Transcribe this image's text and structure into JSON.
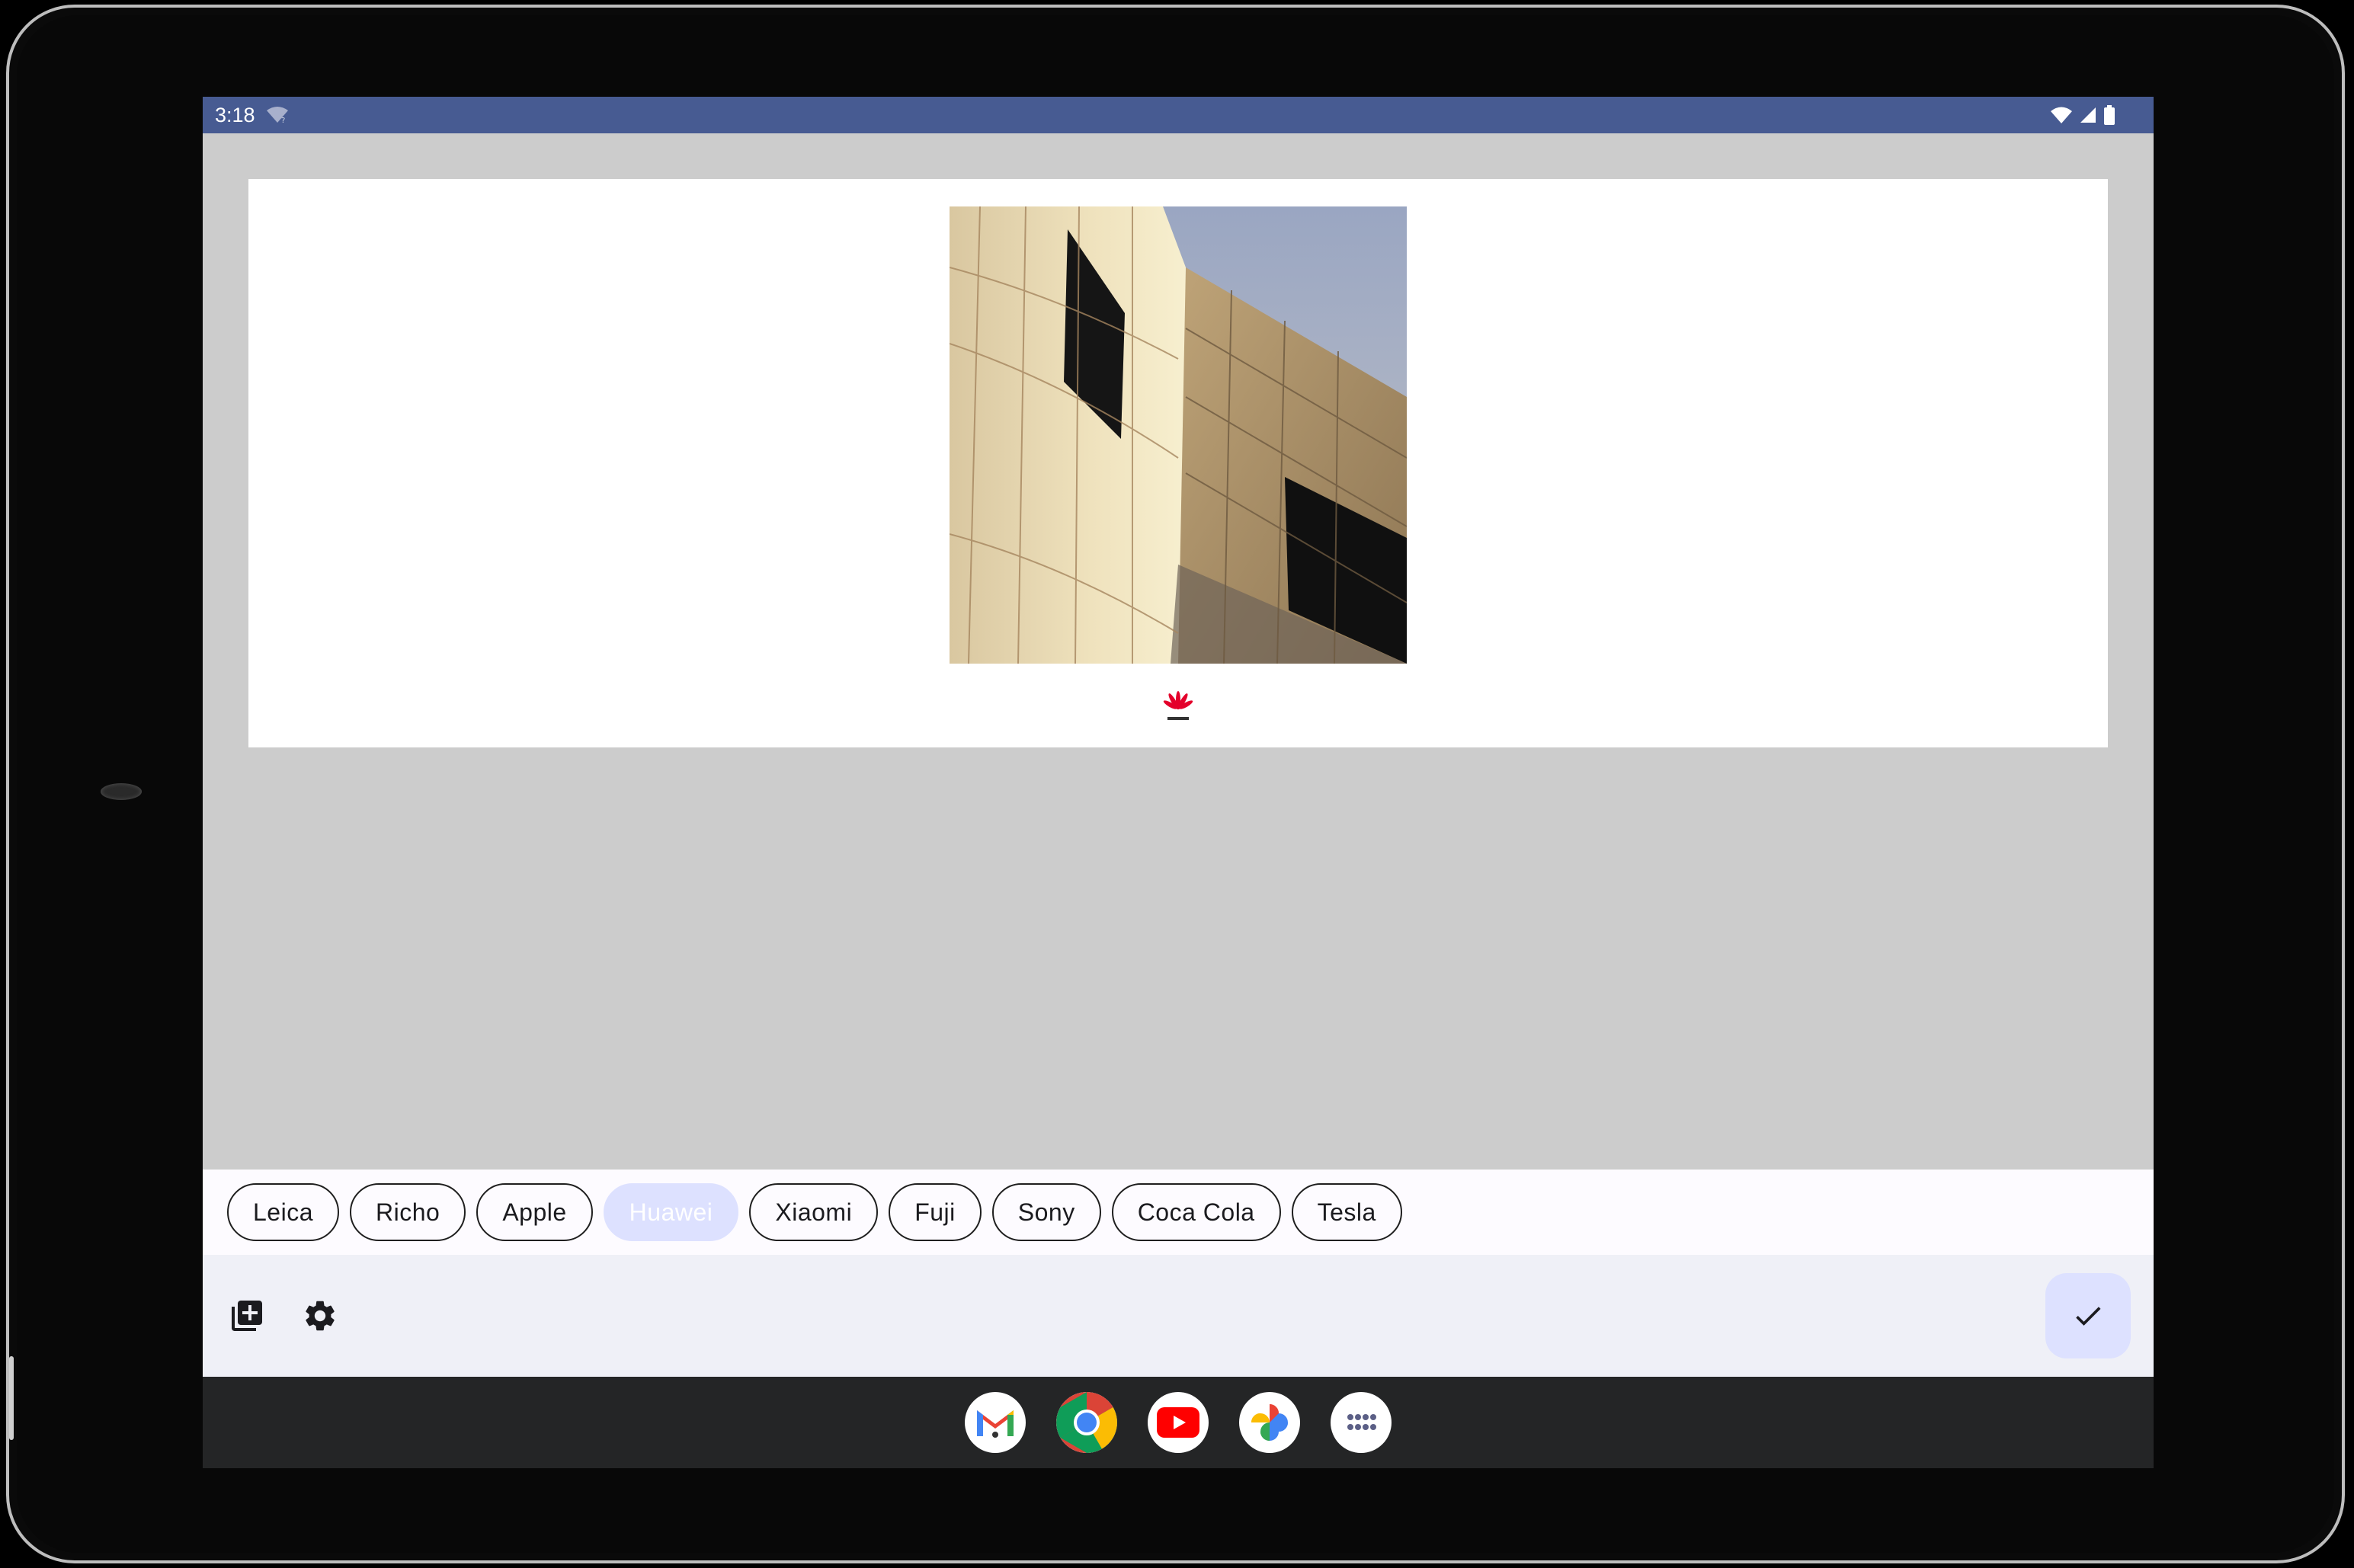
{
  "status_bar": {
    "time": "3:18"
  },
  "chips": [
    {
      "label": "Leica",
      "selected": false
    },
    {
      "label": "Richo",
      "selected": false
    },
    {
      "label": "Apple",
      "selected": false
    },
    {
      "label": "Huawei",
      "selected": true
    },
    {
      "label": "Xiaomi",
      "selected": false
    },
    {
      "label": "Fuji",
      "selected": false
    },
    {
      "label": "Sony",
      "selected": false
    },
    {
      "label": "Coca Cola",
      "selected": false
    },
    {
      "label": "Tesla",
      "selected": false
    }
  ],
  "toolbar": {
    "add_icon": "add-photo-icon",
    "settings_icon": "gear-icon",
    "confirm_icon": "check-icon"
  },
  "dock": [
    "gmail-icon",
    "chrome-icon",
    "youtube-icon",
    "photos-icon",
    "app-drawer-icon"
  ],
  "colors": {
    "status_bar": "#475b92",
    "selected_chip": "#dde1ff",
    "canvas_bg": "#cccccc",
    "brand_red": "#e4002b"
  }
}
